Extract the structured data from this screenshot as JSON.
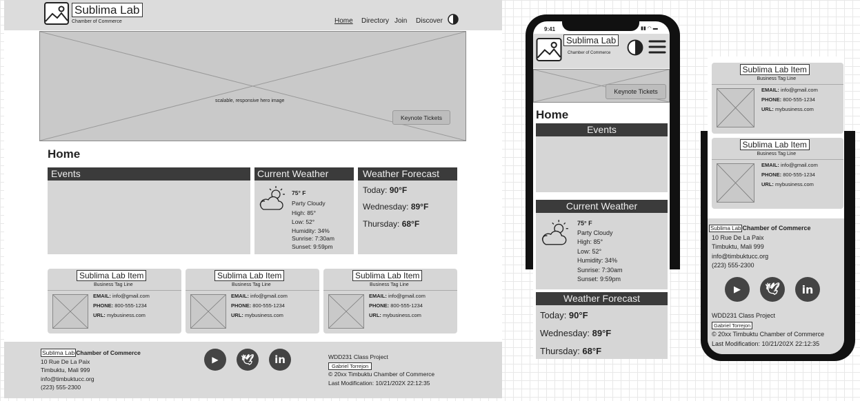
{
  "brand": {
    "name": "Sublima Lab",
    "tagline": "Chamber of Commerce"
  },
  "nav": [
    "Home",
    "Directory",
    "Join",
    "Discover"
  ],
  "hero": {
    "caption": "scalable, responsive hero image",
    "button": "Keynote Tickets"
  },
  "page_title": "Home",
  "events": {
    "title": "Events"
  },
  "weather": {
    "title": "Current Weather",
    "temp": "75° F",
    "desc": "Party Cloudy",
    "high": "High: 85°",
    "low": "Low: 52°",
    "humidity": "Humidity: 34%",
    "sunrise": "Sunrise: 7:30am",
    "sunset": "Sunset: 9:59pm"
  },
  "forecast": {
    "title": "Weather Forecast",
    "days": [
      {
        "day": "Today: ",
        "temp": "90°F"
      },
      {
        "day": "Wednesday: ",
        "temp": "89°F"
      },
      {
        "day": "Thursday: ",
        "temp": "68°F"
      }
    ]
  },
  "business": {
    "title": "Sublima Lab Item",
    "tagline": "Business Tag Line",
    "email_label": "EMAIL:",
    "email": "info@gmail.com",
    "phone_label": "PHONE:",
    "phone": "800-555-1234",
    "url_label": "URL:",
    "url": "mybusiness.com"
  },
  "footer": {
    "logo_text": "Sublima Lab",
    "org": "Chamber of Commerce",
    "address1": "10 Rue De La Paix",
    "address2": "Timbuktu, Mali 999",
    "email": "info@timbuktucc.org",
    "phone": "(223) 555-2300",
    "project": "WDD231 Class Project",
    "author": "Gabriel Torrejon",
    "copyright": "© 20xx Timbuktu Chamber of Commerce",
    "modified": "Last Modification: 10/21/202X 22:12:35"
  },
  "mobile": {
    "time": "9:41"
  }
}
